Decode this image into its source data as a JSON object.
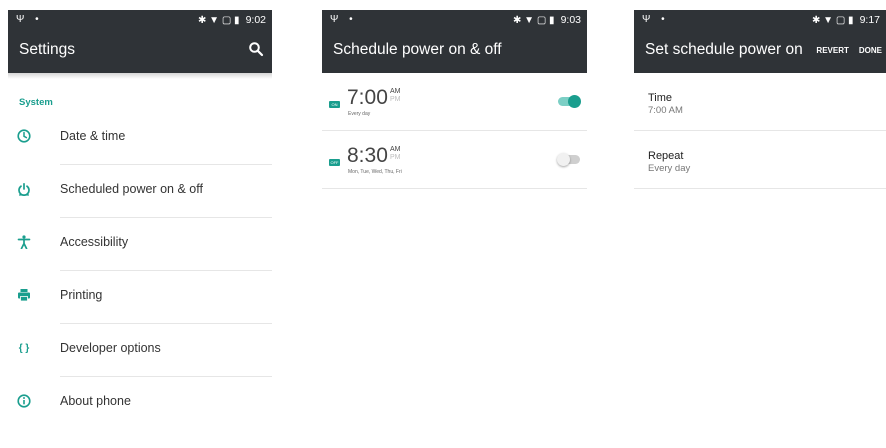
{
  "colors": {
    "accent": "#1a9e8e",
    "appbar": "#2f3337"
  },
  "screens": [
    {
      "status": {
        "left_icons": "Ψ •",
        "right_icons": "✱ ▼ ▢ ▮",
        "time": "9:02"
      },
      "title": "Settings",
      "section_title": "System",
      "items": [
        {
          "label": "Date & time",
          "icon": "clock-icon"
        },
        {
          "label": "Scheduled power on & off",
          "icon": "power-icon"
        },
        {
          "label": "Accessibility",
          "icon": "accessibility-icon"
        },
        {
          "label": "Printing",
          "icon": "printer-icon"
        },
        {
          "label": "Developer options",
          "icon": "braces-icon",
          "glyph": "{ }"
        },
        {
          "label": "About phone",
          "icon": "info-icon"
        }
      ]
    },
    {
      "status": {
        "left_icons": "Ψ •",
        "right_icons": "✱ ▼ ▢ ▮",
        "time": "9:03"
      },
      "title": "Schedule power on & off",
      "alarms": [
        {
          "badge": "ON",
          "time": "7:00",
          "am": "AM",
          "pm": "PM",
          "days": "Every day",
          "enabled": true
        },
        {
          "badge": "OFF",
          "time": "8:30",
          "am": "AM",
          "pm": "PM",
          "days": "Mon, Tue, Wed, Thu, Fri",
          "enabled": false
        }
      ]
    },
    {
      "status": {
        "left_icons": "Ψ •",
        "right_icons": "✱ ▼ ▢ ▮",
        "time": "9:17"
      },
      "title": "Set schedule power on",
      "actions": {
        "revert": "REVERT",
        "done": "DONE"
      },
      "prefs": [
        {
          "title": "Time",
          "summary": "7:00 AM"
        },
        {
          "title": "Repeat",
          "summary": "Every day"
        }
      ]
    }
  ]
}
